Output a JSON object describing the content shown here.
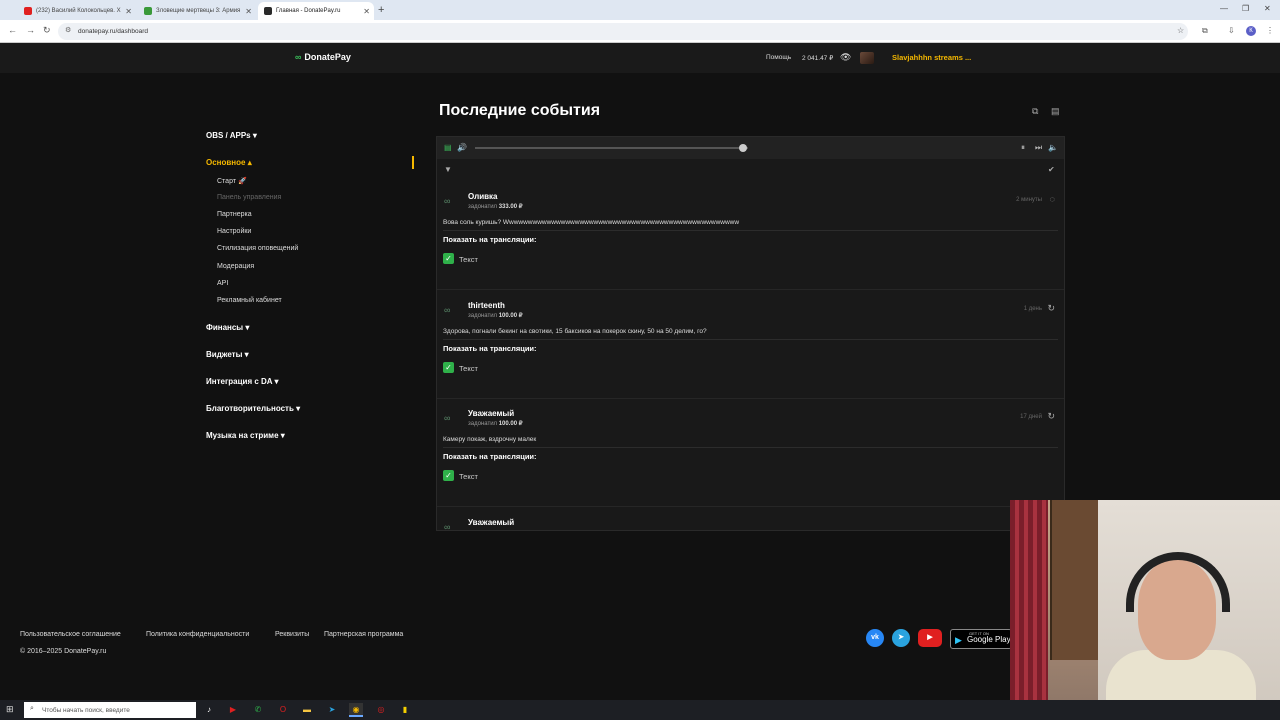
{
  "browser": {
    "tabs": [
      {
        "title": "(232) Василий Колокольцев. Х",
        "color": "#e02020",
        "active": false
      },
      {
        "title": "Зловещие мертвецы 3: Армия",
        "color": "#3a9a3a",
        "active": false
      },
      {
        "title": "Главная - DonatePay.ru",
        "color": "#2a2a2a",
        "active": true
      }
    ],
    "new_tab": "+",
    "url": "donatepay.ru/dashboard"
  },
  "header": {
    "logo": "DonatePay",
    "help": "Помощь",
    "balance": "2 041.47 ₽",
    "stream_name": "Slavjahhhn streams ..."
  },
  "sidebar": {
    "sections": [
      {
        "label": "OBS / APPs ▾",
        "active": false
      },
      {
        "label": "Основное ▴",
        "active": true
      },
      {
        "label": "Финансы ▾",
        "active": false
      },
      {
        "label": "Виджеты ▾",
        "active": false
      },
      {
        "label": "Интеграция с DA ▾",
        "active": false
      },
      {
        "label": "Благотворительность ▾",
        "active": false
      },
      {
        "label": "Музыка на стриме ▾",
        "active": false
      }
    ],
    "items": [
      {
        "label": "Старт 🚀"
      },
      {
        "label": "Панель управления"
      },
      {
        "label": "Партнерка"
      },
      {
        "label": "Настройки"
      },
      {
        "label": "Стилизация оповещений"
      },
      {
        "label": "Модерация"
      },
      {
        "label": "API"
      },
      {
        "label": "Рекламный кабинет"
      }
    ]
  },
  "main": {
    "title": "Последние события",
    "player_progress": 0.98,
    "events": [
      {
        "name": "Оливка",
        "action": "задонатил",
        "amount": "333.00 ₽",
        "time": "2 минуты",
        "message": "Вова соль куришь? Wwwwwwwwwwwwwwwwwwwwwwwwwwwwwwwwwwwwwwwwwwwwwwwwww",
        "show_label": "Показать на трансляции:",
        "option": "Текст"
      },
      {
        "name": "thirteenth",
        "action": "задонатил",
        "amount": "100.00 ₽",
        "time": "1 день",
        "message": "Здорова, погнали бекинг на свотики, 15 баксиков на покерок скину, 50 на 50 делим, го?",
        "show_label": "Показать на трансляции:",
        "option": "Текст"
      },
      {
        "name": "Уважаемый",
        "action": "задонатил",
        "amount": "100.00 ₽",
        "time": "17 дней",
        "message": "Камеру покаж, вздрочну малек",
        "show_label": "Показать на трансляции:",
        "option": "Текст"
      },
      {
        "name": "Уважаемый",
        "action": "",
        "amount": "",
        "time": "",
        "message": "",
        "show_label": "",
        "option": ""
      }
    ]
  },
  "footer": {
    "links": [
      "Пользовательское соглашение",
      "Политика конфиденциальности",
      "Реквизиты",
      "Партнерская программа"
    ],
    "copyright": "© 2016–2025 DonatePay.ru",
    "google_play_small": "GET IT ON",
    "google_play": "Google Play"
  },
  "taskbar": {
    "search_placeholder": "Чтобы начать поиск, введите"
  },
  "colors": {
    "accent": "#f5b800",
    "brand_green": "#3bbf5a",
    "background": "#111111"
  }
}
